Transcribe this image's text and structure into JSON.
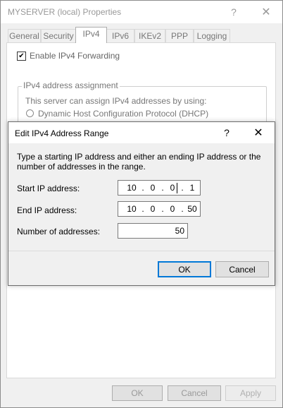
{
  "parent": {
    "title": "MYSERVER (local) Properties",
    "help_glyph": "?",
    "close_glyph": "✕",
    "tabs": [
      {
        "label": "General"
      },
      {
        "label": "Security"
      },
      {
        "label": "IPv4"
      },
      {
        "label": "IPv6"
      },
      {
        "label": "IKEv2"
      },
      {
        "label": "PPP"
      },
      {
        "label": "Logging"
      }
    ],
    "active_tab": "IPv4",
    "forwarding": {
      "label": "Enable IPv4 Forwarding",
      "checked": true,
      "check_glyph": "✔"
    },
    "assignment": {
      "legend": "IPv4 address assignment",
      "description": "This server can assign IPv4 addresses by using:",
      "dhcp_label": "Dynamic Host Configuration Protocol (DHCP)"
    },
    "buttons": {
      "ok": "OK",
      "cancel": "Cancel",
      "apply": "Apply"
    }
  },
  "dialog": {
    "title": "Edit IPv4 Address Range",
    "help_glyph": "?",
    "close_glyph": "✕",
    "instructions": "Type a starting IP address and either an ending IP address or the number of addresses in the range.",
    "start": {
      "label": "Start IP address:",
      "octets": [
        "10",
        "0",
        "0",
        "1"
      ]
    },
    "end": {
      "label": "End IP address:",
      "octets": [
        "10",
        "0",
        "0",
        "50"
      ]
    },
    "count": {
      "label": "Number of addresses:",
      "value": "50"
    },
    "buttons": {
      "ok": "OK",
      "cancel": "Cancel"
    }
  },
  "colors": {
    "focus_border": "#0078d7",
    "window_bg": "#f0f0f0"
  }
}
